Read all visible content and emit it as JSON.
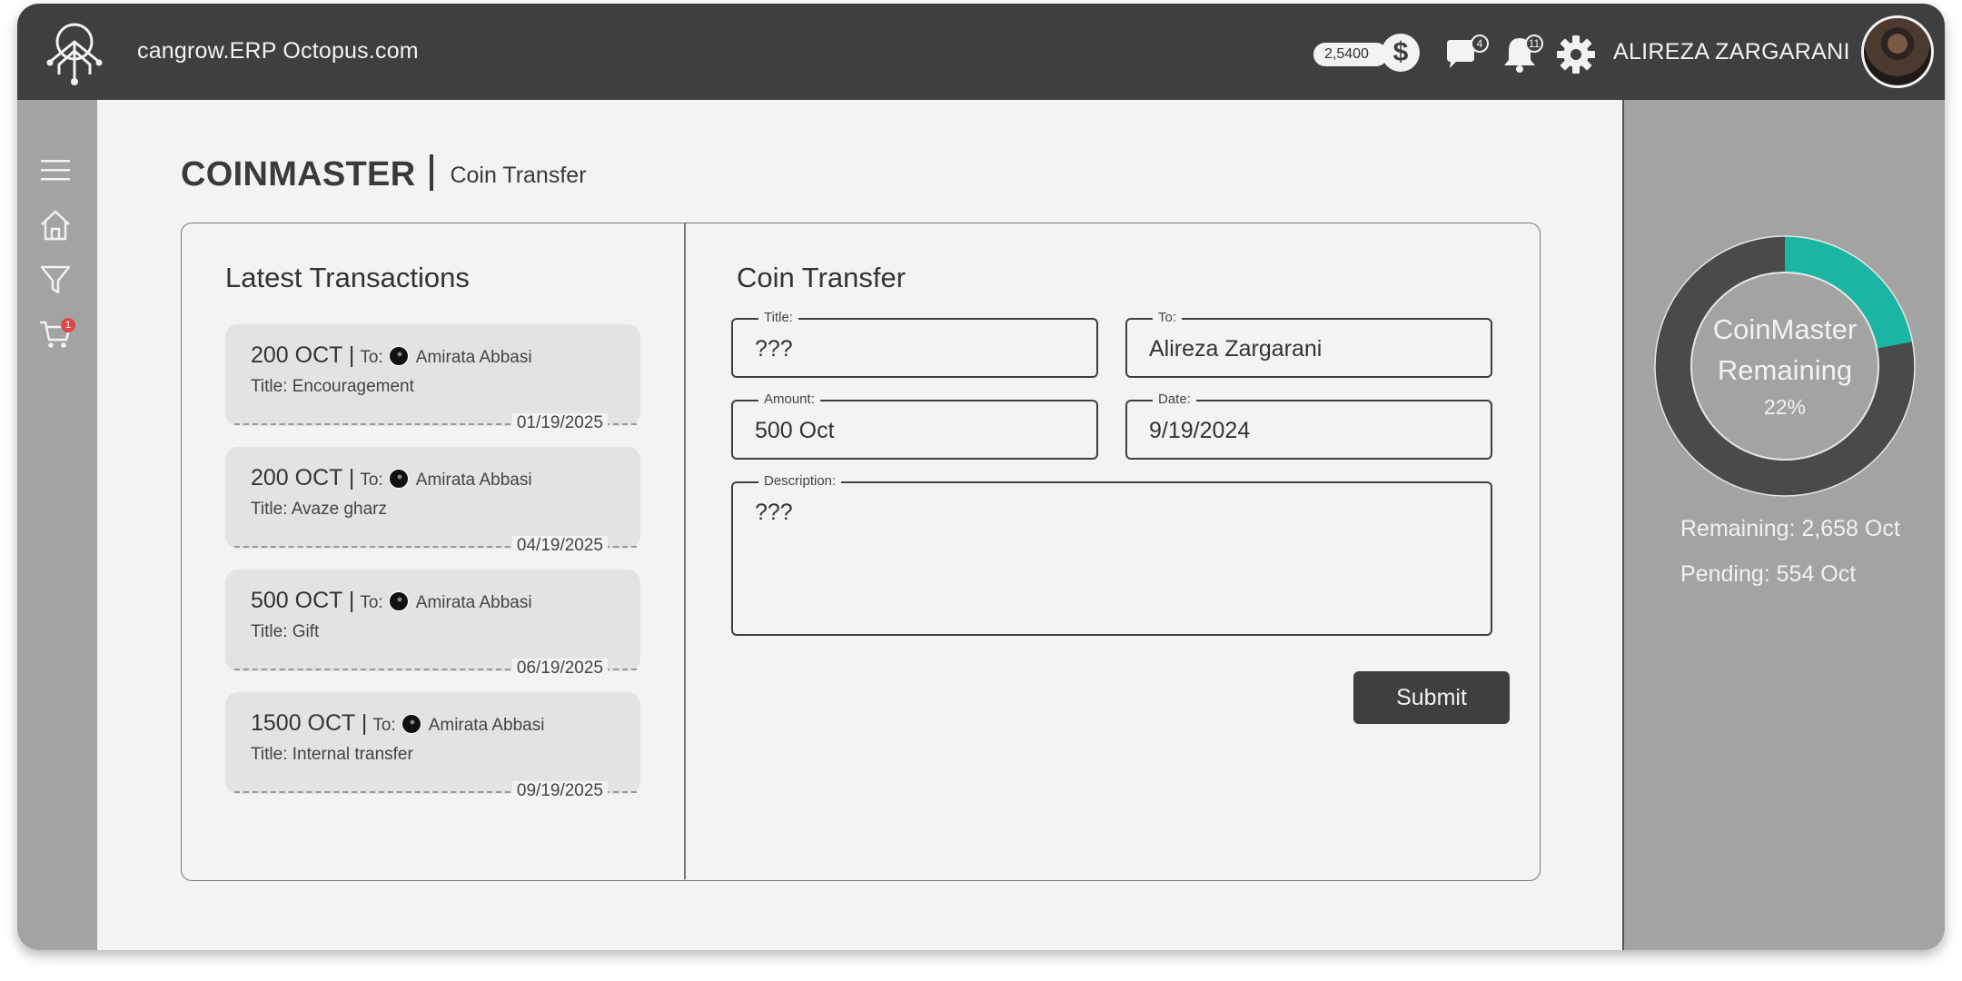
{
  "header": {
    "site_title": "cangrow.ERP Octopus.com",
    "coin_balance": "2,5400",
    "coin_symbol": "$",
    "messages_count": "4",
    "notifications_count": "11",
    "user_name": "ALIREZA ZARGARANI"
  },
  "sidebar": {
    "items": [
      "menu-icon",
      "home-icon",
      "filter-icon",
      "cart-icon"
    ],
    "cart_badge": "1"
  },
  "page": {
    "app_title": "COINMASTER",
    "subtitle": "Coin Transfer"
  },
  "transactions": {
    "heading": "Latest Transactions",
    "to_label": "To:",
    "items": [
      {
        "amount": "200 OCT |",
        "to": "Amirata Abbasi",
        "title": "Title: Encouragement",
        "date": "01/19/2025"
      },
      {
        "amount": "200 OCT |",
        "to": "Amirata Abbasi",
        "title": "Title: Avaze gharz",
        "date": "04/19/2025"
      },
      {
        "amount": "500 OCT |",
        "to": "Amirata Abbasi",
        "title": "Title: Gift",
        "date": "06/19/2025"
      },
      {
        "amount": "1500 OCT |",
        "to": "Amirata Abbasi",
        "title": "Title: Internal transfer",
        "date": "09/19/2025"
      }
    ]
  },
  "form": {
    "heading": "Coin Transfer",
    "title_label": "Title:",
    "title_value": "???",
    "to_label": "To:",
    "to_value": "Alireza Zargarani",
    "amount_label": "Amount:",
    "amount_value": "500 Oct",
    "date_label": "Date:",
    "date_value": "9/19/2024",
    "description_label": "Description:",
    "description_value": "???",
    "submit_label": "Submit"
  },
  "summary": {
    "donut_label_line1": "CoinMaster",
    "donut_label_line2": "Remaining",
    "percent_text": "22%",
    "percent": 22,
    "remaining_text": "Remaining: 2,658 Oct",
    "pending_text": "Pending: 554 Oct",
    "colors": {
      "accent": "#1ab5a3",
      "ring": "#4a4a4a"
    }
  }
}
